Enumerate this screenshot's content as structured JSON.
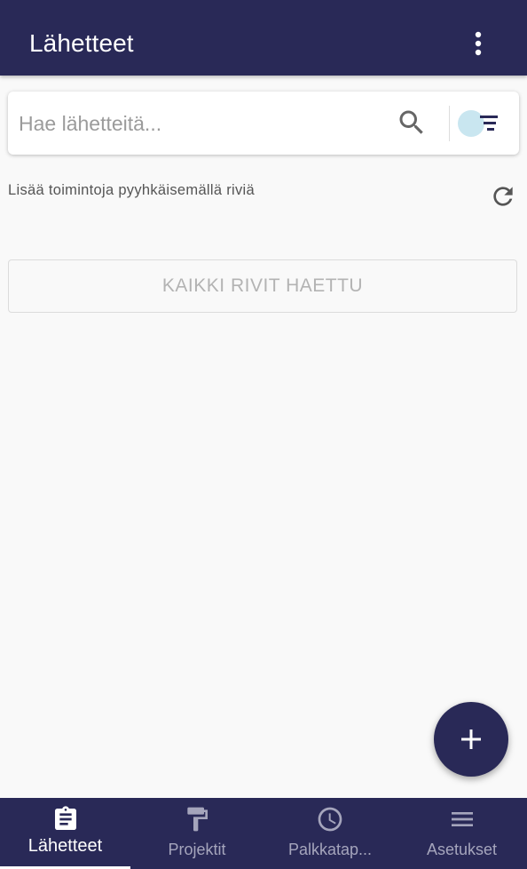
{
  "header": {
    "title": "Lähetteet",
    "more_icon": "more-vert-icon"
  },
  "search": {
    "placeholder": "Hae lähetteitä...",
    "value": "",
    "search_icon": "search-icon",
    "filter_icon": "filter-list-icon"
  },
  "list": {
    "hint": "Lisää toimintoja pyyhkäisemällä riviä",
    "refresh_icon": "refresh-icon",
    "all_rows_label": "KAIKKI RIVIT HAETTU"
  },
  "fab": {
    "icon": "add-icon"
  },
  "bottom_nav": {
    "items": [
      {
        "label": "Lähetteet",
        "icon": "clipboard-icon",
        "active": true
      },
      {
        "label": "Projektit",
        "icon": "paint-roller-icon",
        "active": false
      },
      {
        "label": "Palkkatap...",
        "icon": "clock-icon",
        "active": false
      },
      {
        "label": "Asetukset",
        "icon": "menu-icon",
        "active": false
      }
    ]
  },
  "colors": {
    "primary": "#292957",
    "background": "#f9f9f9",
    "nav_inactive": "#a5a5bc",
    "filter_ripple": "#c9e6f0"
  }
}
